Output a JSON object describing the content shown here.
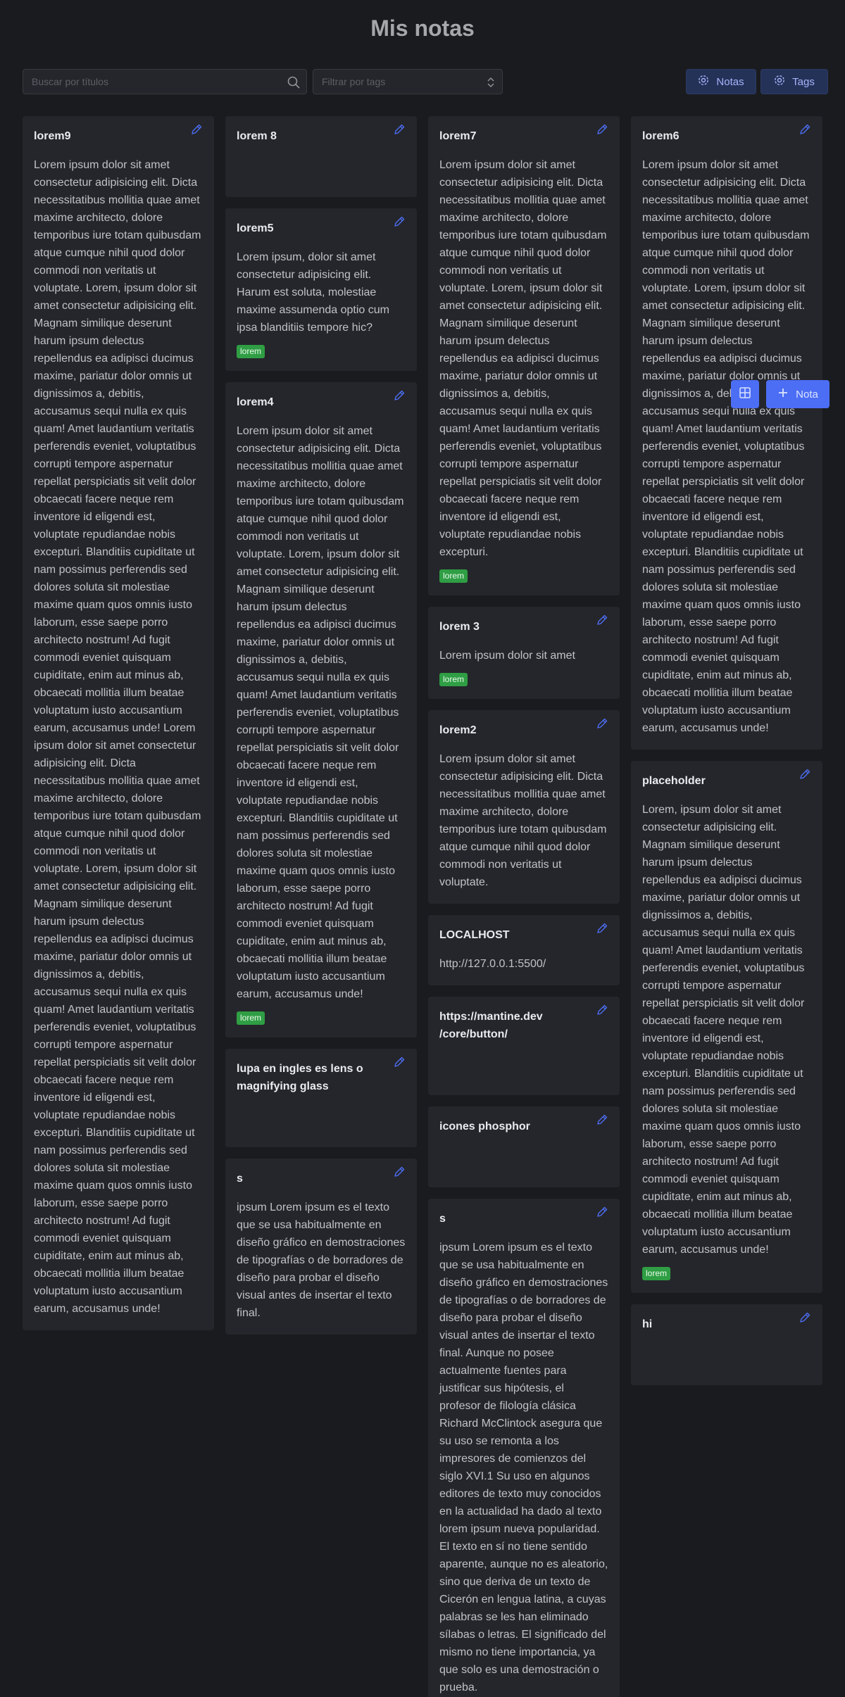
{
  "page": {
    "title": "Mis notas"
  },
  "toolbar": {
    "search_placeholder": "Buscar por títulos",
    "filter_placeholder": "Filtrar por tags",
    "notes_button": "Notas",
    "tags_button": "Tags"
  },
  "fab": {
    "new_note_label": "Nota"
  },
  "colors": {
    "background": "#1a1b1e",
    "card": "#25262b",
    "accent": "#4c6ef5",
    "tag": "#2f9e44"
  },
  "columns": [
    [
      {
        "title": "lorem9",
        "body": "Lorem ipsum dolor sit amet consectetur adipisicing elit. Dicta necessitatibus mollitia quae amet maxime architecto, dolore temporibus iure totam quibusdam atque cumque nihil quod dolor commodi non veritatis ut voluptate. Lorem, ipsum dolor sit amet consectetur adipisicing elit. Magnam similique deserunt harum ipsum delectus repellendus ea adipisci ducimus maxime, pariatur dolor omnis ut dignissimos a, debitis, accusamus sequi nulla ex quis quam! Amet laudantium veritatis perferendis eveniet, voluptatibus corrupti tempore aspernatur repellat perspiciatis sit velit dolor obcaecati facere neque rem inventore id eligendi est, voluptate repudiandae nobis excepturi. Blanditiis cupiditate ut nam possimus perferendis sed dolores soluta sit molestiae maxime quam quos omnis iusto laborum, esse saepe porro architecto nostrum! Ad fugit commodi eveniet quisquam cupiditate, enim aut minus ab, obcaecati mollitia illum beatae voluptatum iusto accusantium earum, accusamus unde! Lorem ipsum dolor sit amet consectetur adipisicing elit. Dicta necessitatibus mollitia quae amet maxime architecto, dolore temporibus iure totam quibusdam atque cumque nihil quod dolor commodi non veritatis ut voluptate. Lorem, ipsum dolor sit amet consectetur adipisicing elit. Magnam similique deserunt harum ipsum delectus repellendus ea adipisci ducimus maxime, pariatur dolor omnis ut dignissimos a, debitis, accusamus sequi nulla ex quis quam! Amet laudantium veritatis perferendis eveniet, voluptatibus corrupti tempore aspernatur repellat perspiciatis sit velit dolor obcaecati facere neque rem inventore id eligendi est, voluptate repudiandae nobis excepturi. Blanditiis cupiditate ut nam possimus perferendis sed dolores soluta sit molestiae maxime quam quos omnis iusto laborum, esse saepe porro architecto nostrum! Ad fugit commodi eveniet quisquam cupiditate, enim aut minus ab, obcaecati mollitia illum beatae voluptatum iusto accusantium earum, accusamus unde!",
        "tag": ""
      }
    ],
    [
      {
        "title": "lorem 8",
        "body": "",
        "tag": ""
      },
      {
        "title": "lorem5",
        "body": "Lorem ipsum, dolor sit amet consectetur adipisicing elit. Harum est soluta, molestiae maxime assumenda optio cum ipsa blanditiis tempore hic?",
        "tag": "lorem"
      },
      {
        "title": "lorem4",
        "body": "Lorem ipsum dolor sit amet consectetur adipisicing elit. Dicta necessitatibus mollitia quae amet maxime architecto, dolore temporibus iure totam quibusdam atque cumque nihil quod dolor commodi non veritatis ut voluptate. Lorem, ipsum dolor sit amet consectetur adipisicing elit. Magnam similique deserunt harum ipsum delectus repellendus ea adipisci ducimus maxime, pariatur dolor omnis ut dignissimos a, debitis, accusamus sequi nulla ex quis quam! Amet laudantium veritatis perferendis eveniet, voluptatibus corrupti tempore aspernatur repellat perspiciatis sit velit dolor obcaecati facere neque rem inventore id eligendi est, voluptate repudiandae nobis excepturi. Blanditiis cupiditate ut nam possimus perferendis sed dolores soluta sit molestiae maxime quam quos omnis iusto laborum, esse saepe porro architecto nostrum! Ad fugit commodi eveniet quisquam cupiditate, enim aut minus ab, obcaecati mollitia illum beatae voluptatum iusto accusantium earum, accusamus unde!",
        "tag": "lorem"
      },
      {
        "title": "lupa en ingles es lens o magnifying glass",
        "body": "",
        "tag": ""
      },
      {
        "title": "s",
        "body": "ipsum Lorem ipsum es el texto que se usa habitualmente en diseño gráfico en demostraciones de tipografías o de borradores de diseño para probar el diseño visual antes de insertar el texto final.",
        "tag": ""
      }
    ],
    [
      {
        "title": "lorem7",
        "body": "Lorem ipsum dolor sit amet consectetur adipisicing elit. Dicta necessitatibus mollitia quae amet maxime architecto, dolore temporibus iure totam quibusdam atque cumque nihil quod dolor commodi non veritatis ut voluptate. Lorem, ipsum dolor sit amet consectetur adipisicing elit. Magnam similique deserunt harum ipsum delectus repellendus ea adipisci ducimus maxime, pariatur dolor omnis ut dignissimos a, debitis, accusamus sequi nulla ex quis quam! Amet laudantium veritatis perferendis eveniet, voluptatibus corrupti tempore aspernatur repellat perspiciatis sit velit dolor obcaecati facere neque rem inventore id eligendi est, voluptate repudiandae nobis excepturi.",
        "tag": "lorem"
      },
      {
        "title": "lorem 3",
        "body": "Lorem ipsum dolor sit amet",
        "tag": "lorem"
      },
      {
        "title": "lorem2",
        "body": "Lorem ipsum dolor sit amet consectetur adipisicing elit. Dicta necessitatibus mollitia quae amet maxime architecto, dolore temporibus iure totam quibusdam atque cumque nihil quod dolor commodi non veritatis ut voluptate.",
        "tag": ""
      },
      {
        "title": "LOCALHOST",
        "body": "http://127.0.0.1:5500/",
        "tag": ""
      },
      {
        "title": "https://mantine.dev /core/button/",
        "body": "",
        "tag": ""
      },
      {
        "title": "icones phosphor",
        "body": "",
        "tag": ""
      },
      {
        "title": "s",
        "body": "ipsum Lorem ipsum es el texto que se usa habitualmente en diseño gráfico en demostraciones de tipografías o de borradores de diseño para probar el diseño visual antes de insertar el texto final. Aunque no posee actualmente fuentes para justificar sus hipótesis, el profesor de filología clásica Richard McClintock asegura que su uso se remonta a los impresores de comienzos del siglo XVI.1 Su uso en algunos editores de texto muy conocidos en la actualidad ha dado al texto lorem ipsum nueva popularidad. El texto en sí no tiene sentido aparente, aunque no es aleatorio, sino que deriva de un texto de Cicerón en lengua latina, a cuyas palabras se les han eliminado sílabas o letras. El significado del mismo no tiene importancia, ya que solo es una demostración o prueba.",
        "tag": ""
      }
    ],
    [
      {
        "title": "lorem6",
        "body": "Lorem ipsum dolor sit amet consectetur adipisicing elit. Dicta necessitatibus mollitia quae amet maxime architecto, dolore temporibus iure totam quibusdam atque cumque nihil quod dolor commodi non veritatis ut voluptate. Lorem, ipsum dolor sit amet consectetur adipisicing elit. Magnam similique deserunt harum ipsum delectus repellendus ea adipisci ducimus maxime, pariatur dolor omnis ut dignissimos a, debitis, accusamus sequi nulla ex quis quam! Amet laudantium veritatis perferendis eveniet, voluptatibus corrupti tempore aspernatur repellat perspiciatis sit velit dolor obcaecati facere neque rem inventore id eligendi est, voluptate repudiandae nobis excepturi. Blanditiis cupiditate ut nam possimus perferendis sed dolores soluta sit molestiae maxime quam quos omnis iusto laborum, esse saepe porro architecto nostrum! Ad fugit commodi eveniet quisquam cupiditate, enim aut minus ab, obcaecati mollitia illum beatae voluptatum iusto accusantium earum, accusamus unde!",
        "tag": ""
      },
      {
        "title": "placeholder",
        "body": "Lorem, ipsum dolor sit amet consectetur adipisicing elit. Magnam similique deserunt harum ipsum delectus repellendus ea adipisci ducimus maxime, pariatur dolor omnis ut dignissimos a, debitis, accusamus sequi nulla ex quis quam! Amet laudantium veritatis perferendis eveniet, voluptatibus corrupti tempore aspernatur repellat perspiciatis sit velit dolor obcaecati facere neque rem inventore id eligendi est, voluptate repudiandae nobis excepturi. Blanditiis cupiditate ut nam possimus perferendis sed dolores soluta sit molestiae maxime quam quos omnis iusto laborum, esse saepe porro architecto nostrum! Ad fugit commodi eveniet quisquam cupiditate, enim aut minus ab, obcaecati mollitia illum beatae voluptatum iusto accusantium earum, accusamus unde!",
        "tag": "lorem"
      },
      {
        "title": "hi",
        "body": "",
        "tag": ""
      }
    ]
  ]
}
